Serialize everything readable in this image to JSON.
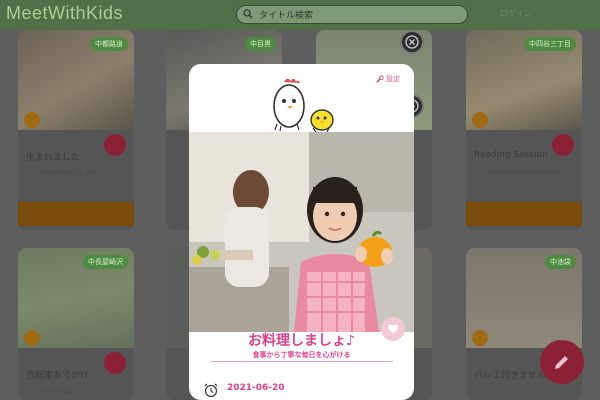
{
  "app": {
    "logo": "MeetWithKids",
    "header_right": "ログイン"
  },
  "search": {
    "placeholder": "タイトル検索"
  },
  "cards": [
    {
      "tag": "中都路道",
      "title": "生まれました",
      "desc": "2020年8月最初に生まれた"
    },
    {
      "tag": "中目黒",
      "title": "",
      "desc": ""
    },
    {
      "tag": "",
      "title": "",
      "desc": ""
    },
    {
      "tag": "中四谷三丁目",
      "title": "Reading Session",
      "desc": "Let's go to a reading session"
    },
    {
      "tag": "中長屋崎沢",
      "title": "自転車おでかけ",
      "desc": "初めての自転車"
    },
    {
      "tag": "",
      "title": "",
      "desc": ""
    },
    {
      "tag": "",
      "title": "",
      "desc": ""
    },
    {
      "tag": "中池袋",
      "title": "バレエ行きません",
      "desc": ""
    }
  ],
  "modal": {
    "settings_label": "設定",
    "title": "お料理しましょ♪",
    "subtitle": "食事から丁寧な毎日を心がける",
    "date": "2021-06-20"
  },
  "icons": {
    "search": "search-icon",
    "close": "close-icon",
    "download": "download-icon",
    "settings": "wrench-icon",
    "heart": "heart-icon",
    "clock": "alarm-clock-icon",
    "edit": "pencil-icon"
  },
  "colors": {
    "header_bg": "#527048",
    "accent_pink": "#e0408a",
    "tag_green": "#4e8a41",
    "bar_orange": "#7a4d0a",
    "heart_red": "#8c2136"
  }
}
